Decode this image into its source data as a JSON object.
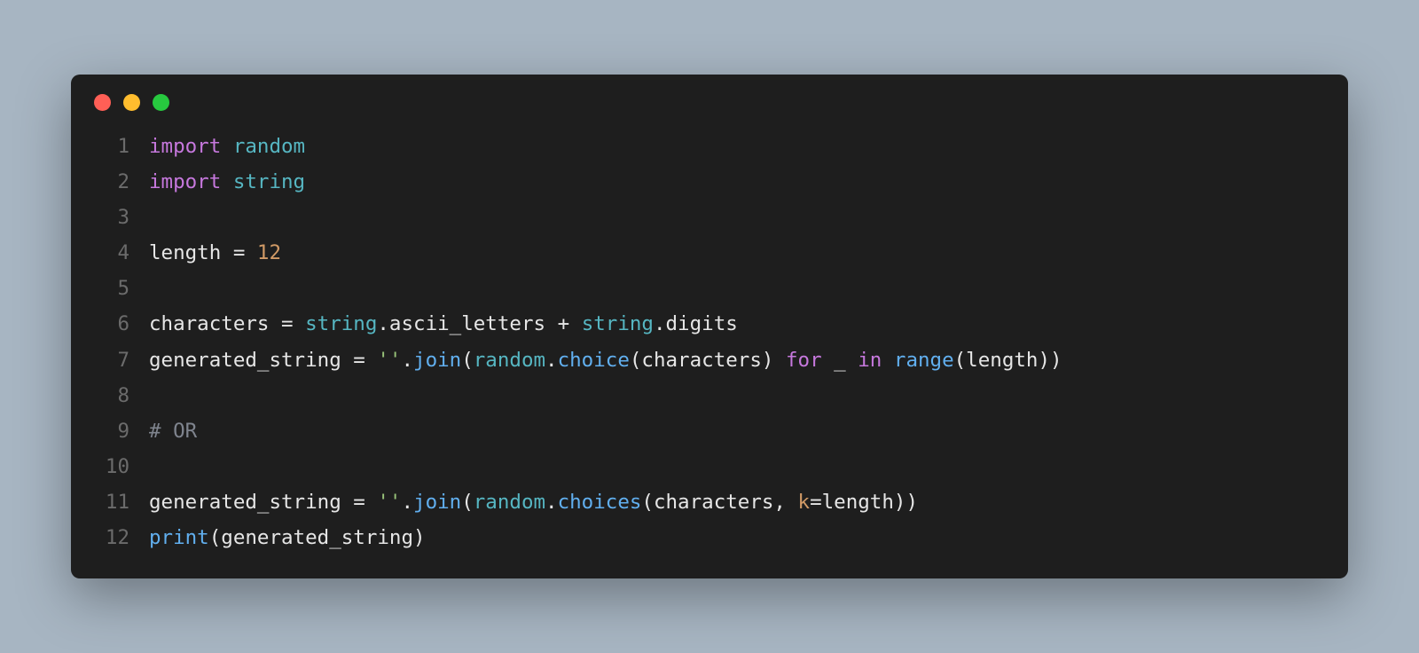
{
  "window": {
    "traffic_lights": {
      "red": "#ff5f56",
      "yellow": "#ffbd2e",
      "green": "#27c93f"
    }
  },
  "code": {
    "language": "python",
    "lines": [
      {
        "n": "1",
        "tokens": [
          {
            "t": "import",
            "c": "kw"
          },
          {
            "t": " ",
            "c": "ident"
          },
          {
            "t": "random",
            "c": "mod"
          }
        ]
      },
      {
        "n": "2",
        "tokens": [
          {
            "t": "import",
            "c": "kw"
          },
          {
            "t": " ",
            "c": "ident"
          },
          {
            "t": "string",
            "c": "mod"
          }
        ]
      },
      {
        "n": "3",
        "tokens": []
      },
      {
        "n": "4",
        "tokens": [
          {
            "t": "length ",
            "c": "ident"
          },
          {
            "t": "=",
            "c": "op"
          },
          {
            "t": " ",
            "c": "ident"
          },
          {
            "t": "12",
            "c": "num"
          }
        ]
      },
      {
        "n": "5",
        "tokens": []
      },
      {
        "n": "6",
        "tokens": [
          {
            "t": "characters ",
            "c": "ident"
          },
          {
            "t": "=",
            "c": "op"
          },
          {
            "t": " ",
            "c": "ident"
          },
          {
            "t": "string",
            "c": "mod"
          },
          {
            "t": ".ascii_letters ",
            "c": "ident"
          },
          {
            "t": "+",
            "c": "op"
          },
          {
            "t": " ",
            "c": "ident"
          },
          {
            "t": "string",
            "c": "mod"
          },
          {
            "t": ".digits",
            "c": "ident"
          }
        ]
      },
      {
        "n": "7",
        "tokens": [
          {
            "t": "generated_string ",
            "c": "ident"
          },
          {
            "t": "=",
            "c": "op"
          },
          {
            "t": " ",
            "c": "ident"
          },
          {
            "t": "''",
            "c": "str"
          },
          {
            "t": ".",
            "c": "ident"
          },
          {
            "t": "join",
            "c": "fn"
          },
          {
            "t": "(",
            "c": "paren"
          },
          {
            "t": "random",
            "c": "mod"
          },
          {
            "t": ".",
            "c": "ident"
          },
          {
            "t": "choice",
            "c": "fn"
          },
          {
            "t": "(characters) ",
            "c": "ident"
          },
          {
            "t": "for",
            "c": "kw"
          },
          {
            "t": " _ ",
            "c": "ident"
          },
          {
            "t": "in",
            "c": "kw"
          },
          {
            "t": " ",
            "c": "ident"
          },
          {
            "t": "range",
            "c": "fn"
          },
          {
            "t": "(length))",
            "c": "ident"
          }
        ]
      },
      {
        "n": "8",
        "tokens": []
      },
      {
        "n": "9",
        "tokens": [
          {
            "t": "# OR",
            "c": "cmt"
          }
        ]
      },
      {
        "n": "10",
        "tokens": []
      },
      {
        "n": "11",
        "tokens": [
          {
            "t": "generated_string ",
            "c": "ident"
          },
          {
            "t": "=",
            "c": "op"
          },
          {
            "t": " ",
            "c": "ident"
          },
          {
            "t": "''",
            "c": "str"
          },
          {
            "t": ".",
            "c": "ident"
          },
          {
            "t": "join",
            "c": "fn"
          },
          {
            "t": "(",
            "c": "paren"
          },
          {
            "t": "random",
            "c": "mod"
          },
          {
            "t": ".",
            "c": "ident"
          },
          {
            "t": "choices",
            "c": "fn"
          },
          {
            "t": "(characters, ",
            "c": "ident"
          },
          {
            "t": "k",
            "c": "param"
          },
          {
            "t": "=length))",
            "c": "ident"
          }
        ]
      },
      {
        "n": "12",
        "tokens": [
          {
            "t": "print",
            "c": "fn"
          },
          {
            "t": "(generated_string)",
            "c": "ident"
          }
        ]
      }
    ]
  }
}
